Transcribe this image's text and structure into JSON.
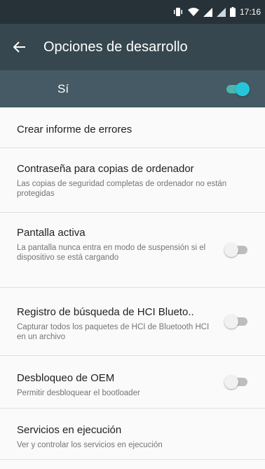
{
  "status_bar": {
    "time": "17:16",
    "icons": [
      "vibrate-icon",
      "wifi-icon",
      "signal-icon",
      "signal-icon",
      "battery-icon"
    ]
  },
  "app_bar": {
    "title": "Opciones de desarrollo",
    "back_icon": "arrow-back-icon"
  },
  "master_switch": {
    "label": "Sí",
    "checked": true
  },
  "settings": [
    {
      "title": "Crear informe de errores",
      "summary": ""
    },
    {
      "title": "Contraseña para copias de ordenador",
      "summary": "Las copias de seguridad completas de ordenador no están protegidas"
    },
    {
      "title": "Pantalla activa",
      "summary": "La pantalla nunca entra en modo de suspensión si el dispositivo se está cargando",
      "checked": false
    },
    {
      "title": "Registro de búsqueda de HCI Blueto..",
      "summary": "Capturar todos los paquetes de HCI de Bluetooth HCI en un archivo",
      "checked": false
    },
    {
      "title": "Desbloqueo de OEM",
      "summary": "Permitir desbloquear el bootloader",
      "checked": false
    },
    {
      "title": "Servicios en ejecución",
      "summary": "Ver y controlar los servicios en ejecución"
    }
  ],
  "colors": {
    "status_bar": "#263238",
    "app_bar": "#37474f",
    "master_bar": "#455a64",
    "accent": "#26c6da"
  }
}
